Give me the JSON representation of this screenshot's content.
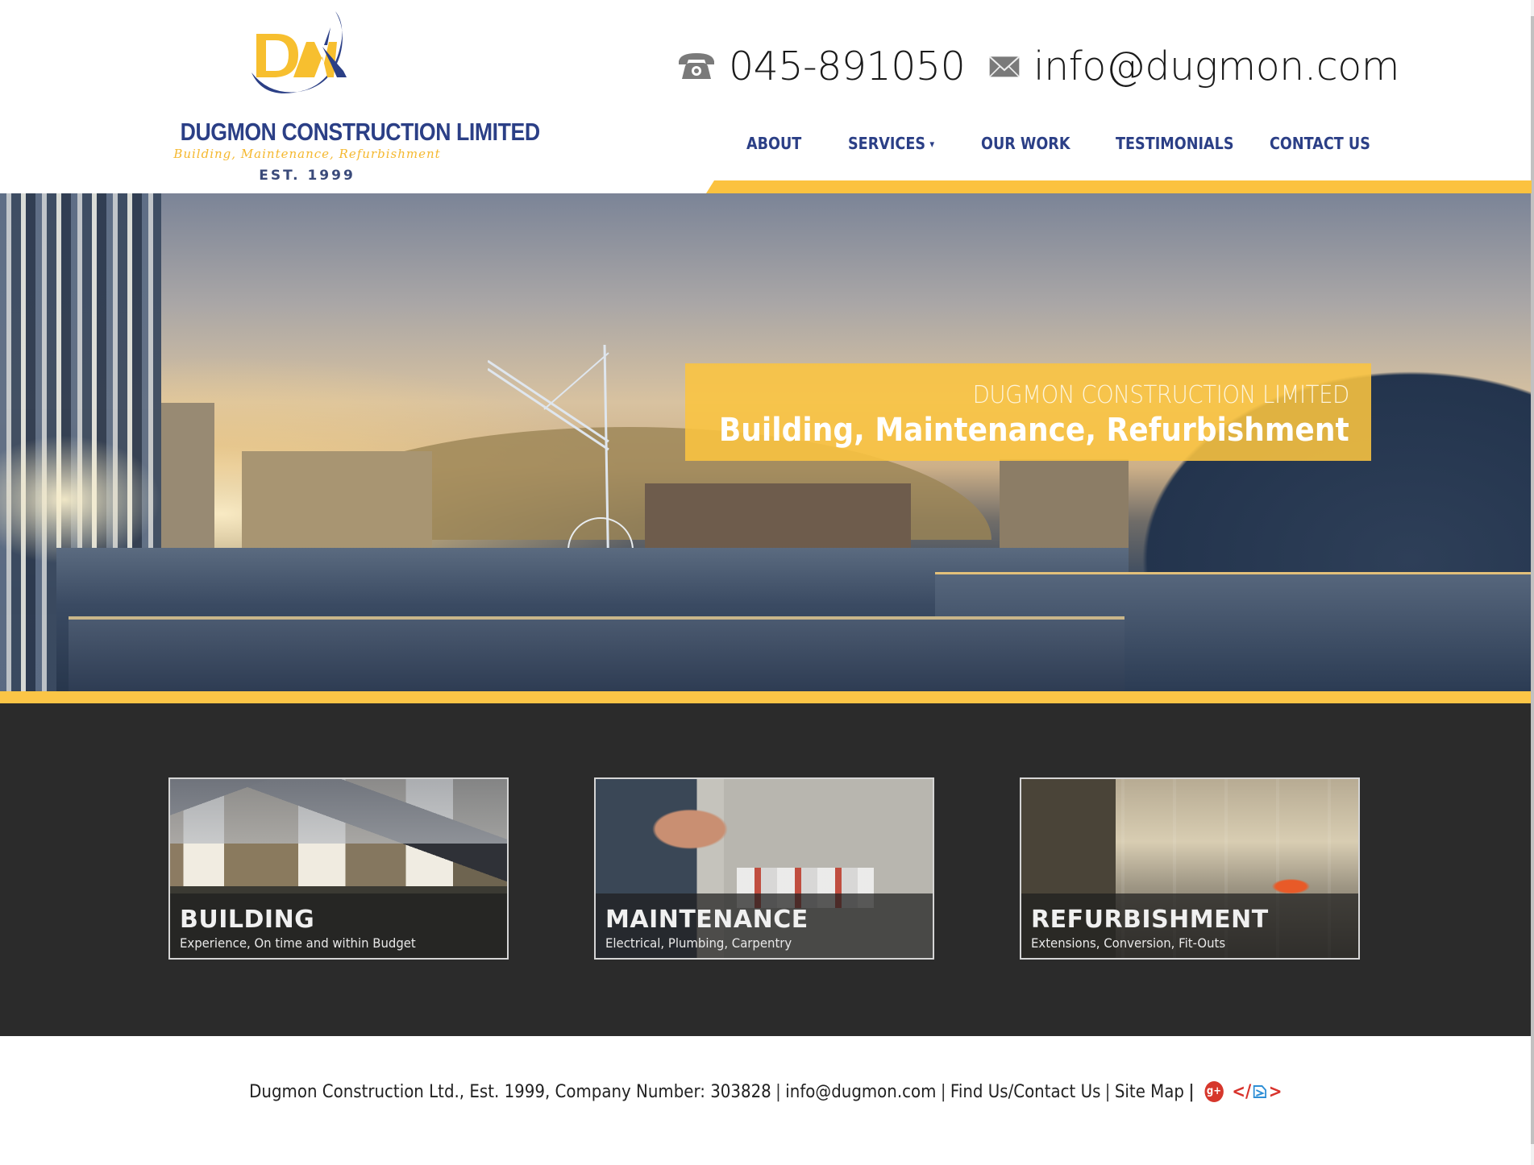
{
  "colors": {
    "brand_navy": "#2b3f86",
    "brand_yellow": "#fbc546",
    "dark_section": "#2b2b2b"
  },
  "logo": {
    "monogram": "DM",
    "name": "DUGMON CONSTRUCTION LIMITED",
    "tagline": "Building, Maintenance, Refurbishment",
    "established": "EST. 1999"
  },
  "contact": {
    "phone_icon": "telephone-icon",
    "phone": "045-891050",
    "email_icon": "envelope-icon",
    "email": "info@dugmon.com"
  },
  "nav": {
    "items": [
      {
        "label": "ABOUT"
      },
      {
        "label": "SERVICES",
        "has_dropdown": true
      },
      {
        "label": "OUR WORK"
      },
      {
        "label": "TESTIMONIALS"
      },
      {
        "label": "CONTACT US"
      }
    ],
    "dropdown_caret": "▾"
  },
  "hero": {
    "caption_sub": "DUGMON CONSTRUCTION LIMITED",
    "caption_main": "Building, Maintenance, Refurbishment"
  },
  "services": [
    {
      "title": "BUILDING",
      "subtitle": "Experience, On time and within Budget"
    },
    {
      "title": "MAINTENANCE",
      "subtitle": "Electrical, Plumbing, Carpentry"
    },
    {
      "title": "REFURBISHMENT",
      "subtitle": "Extensions, Conversion, Fit-Outs"
    }
  ],
  "footer": {
    "company": "Dugmon Construction Ltd., Est. 1999, Company Number: 303828",
    "email_link": "info@dugmon.com",
    "find_us_link": "Find Us/Contact Us",
    "sitemap_link": "Site Map",
    "separator": "|",
    "gplus_label": "g+",
    "dev_logo_left": "</",
    "dev_logo_right": ">"
  }
}
